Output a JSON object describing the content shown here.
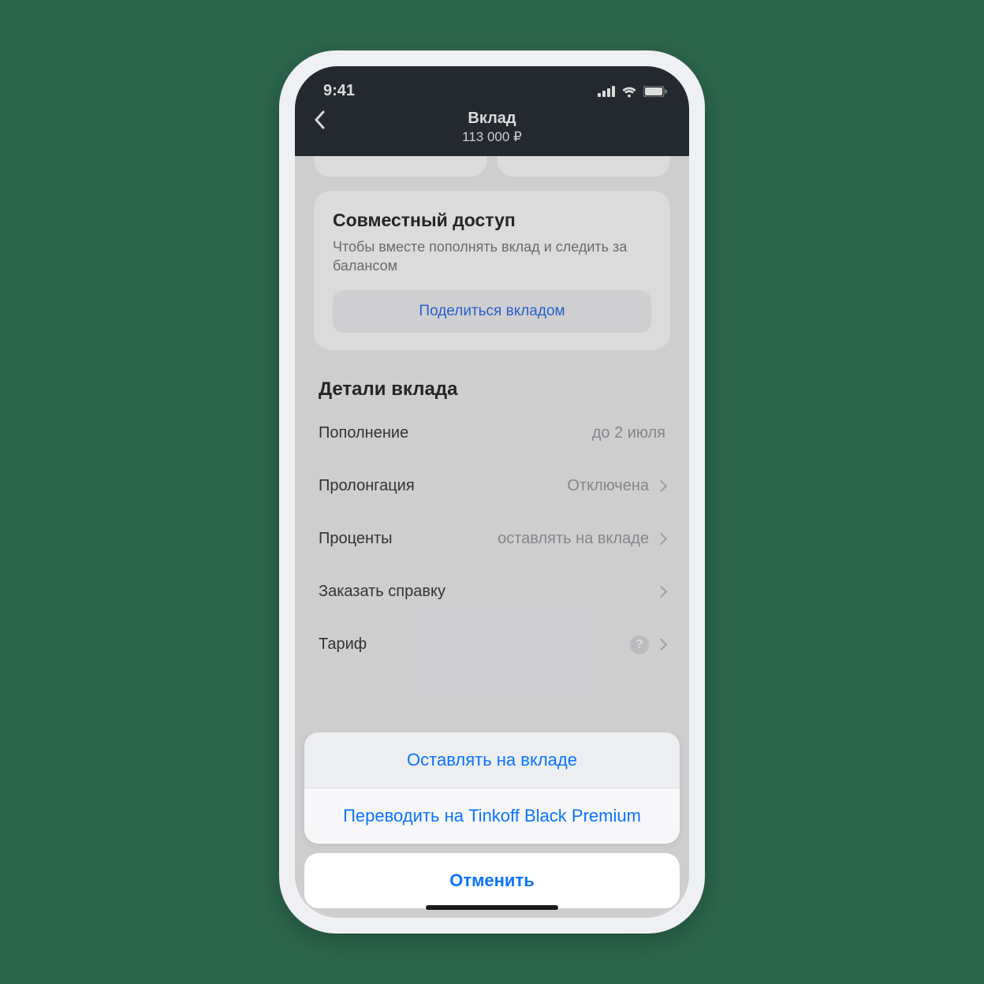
{
  "status": {
    "time": "9:41"
  },
  "header": {
    "title": "Вклад",
    "subtitle": "113 000 ₽"
  },
  "share_card": {
    "title": "Совместный доступ",
    "desc": "Чтобы вместе пополнять вклад и следить за балансом",
    "button": "Поделиться вкладом"
  },
  "details": {
    "title": "Детали вклада",
    "rows": [
      {
        "label": "Пополнение",
        "value": "до 2 июля",
        "chevron": false,
        "help": false
      },
      {
        "label": "Пролонгация",
        "value": "Отключена",
        "chevron": true,
        "help": false
      },
      {
        "label": "Проценты",
        "value": "оставлять на вкладе",
        "chevron": true,
        "help": false
      },
      {
        "label": "Заказать справку",
        "value": "",
        "chevron": true,
        "help": false
      },
      {
        "label": "Тариф",
        "value": "",
        "chevron": true,
        "help": true
      }
    ]
  },
  "sheet": {
    "options": [
      "Оставлять на вкладе",
      "Переводить на Tinkoff Black Premium"
    ],
    "selected": 0,
    "cancel": "Отменить"
  }
}
